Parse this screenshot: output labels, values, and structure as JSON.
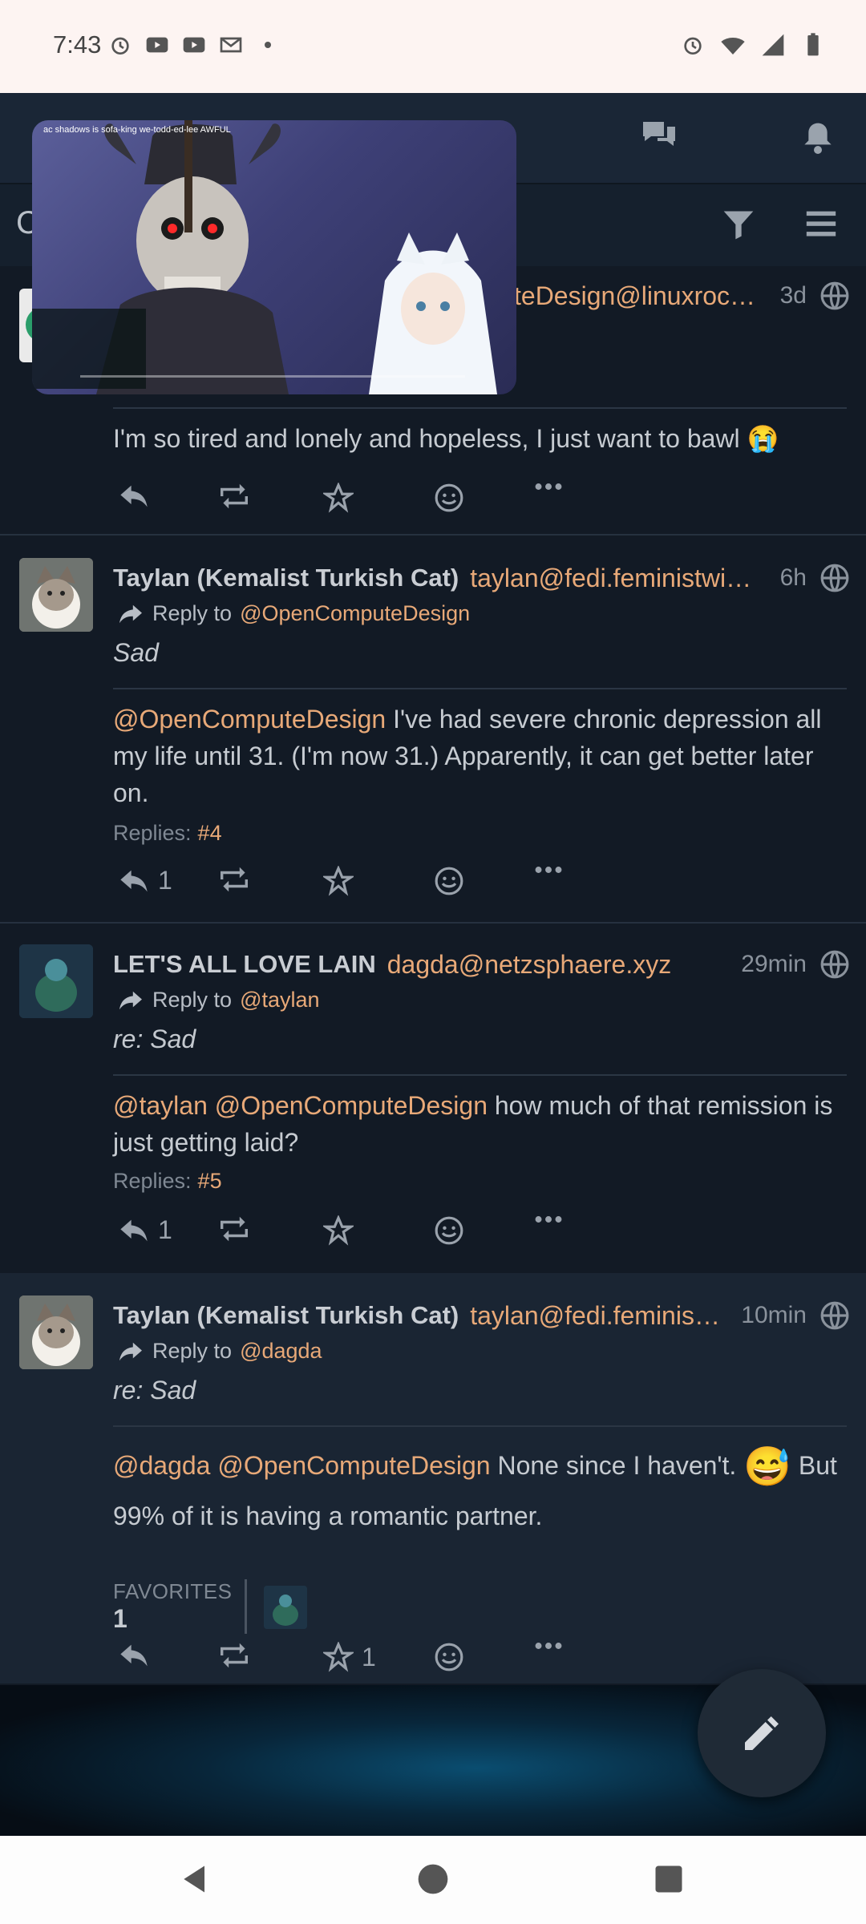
{
  "status": {
    "time": "7:43"
  },
  "header": {
    "title": "C"
  },
  "video": {
    "title": "ac shadows is sofa-king we-todd-ed-lee AWFUL"
  },
  "posts": [
    {
      "handle": "teDesign@linuxroc…",
      "time": "3d",
      "content": "I'm so tired and lonely and hopeless, I just want to bawl 😭"
    },
    {
      "user": "Taylan (Kemalist Turkish Cat)",
      "handle": "taylan@fedi.feministwi…",
      "time": "6h",
      "reply_label": "Reply to",
      "reply_to": "@OpenComputeDesign",
      "subject": "Sad",
      "mention": "@OpenComputeDesign",
      "content": " I've had severe chronic depression all my life until 31. (I'm now 31.) Apparently, it can get better later on.",
      "replies_label": "Replies:",
      "replies_num": "#4",
      "reply_count": "1"
    },
    {
      "user": "LET'S ALL LOVE LAIN",
      "handle": "dagda@netzsphaere.xyz",
      "time": "29min",
      "reply_label": "Reply to",
      "reply_to": "@taylan",
      "subject": "re: Sad",
      "mention1": "@taylan",
      "mention2": "@OpenComputeDesign",
      "content": " how much of that remission is just getting laid?",
      "replies_label": "Replies:",
      "replies_num": "#5",
      "reply_count": "1"
    },
    {
      "user": "Taylan (Kemalist Turkish Cat)",
      "handle": "taylan@fedi.feminis…",
      "time": "10min",
      "reply_label": "Reply to",
      "reply_to": "@dagda",
      "subject": "re: Sad",
      "mention1": "@dagda",
      "mention2": "@OpenComputeDesign",
      "content_a": " None since I haven't.",
      "emoji": "😅",
      "content_b": " But 99% of it is having a romantic partner.",
      "favorites_label": "FAVORITES",
      "favorites_count": "1",
      "fav_count": "1"
    }
  ]
}
